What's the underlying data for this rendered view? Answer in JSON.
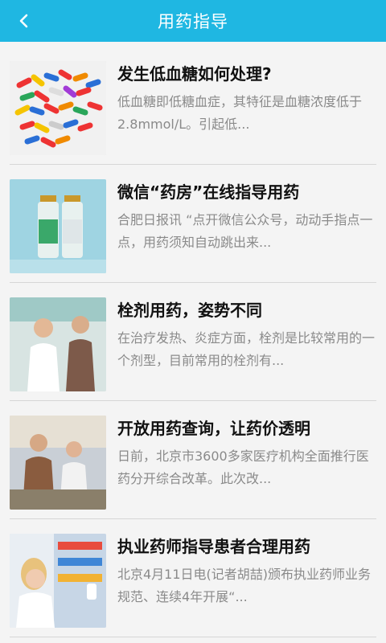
{
  "header": {
    "title": "用药指导",
    "back_icon": "chevron-left-icon"
  },
  "colors": {
    "accent": "#1fb7e2",
    "title_text": "#111111",
    "desc_text": "#8a8a8a"
  },
  "articles": [
    {
      "title": "发生低血糖如何处理?",
      "summary": "低血糖即低糖血症，其特征是血糖浓度低于2.8mmol/L。引起低...",
      "image": "pills-photo"
    },
    {
      "title": "微信“药房”在线指导用药",
      "summary": "合肥日报讯 “点开微信公众号，动动手指点一点，用药须知自动跳出来...",
      "image": "medicine-vials-photo"
    },
    {
      "title": "栓剂用药，姿势不同",
      "summary": "在治疗发热、炎症方面，栓剂是比较常用的一个剂型，目前常用的栓剂有...",
      "image": "doctor-consultation-photo"
    },
    {
      "title": "开放用药查询，让药价透明",
      "summary": "日前，北京市3600多家医疗机构全面推行医药分开综合改革。此次改...",
      "image": "pharmacy-counter-photo"
    },
    {
      "title": "执业药师指导患者合理用药",
      "summary": "北京4月11日电(记者胡喆)颁布执业药师业务规范、连续4年开展“...",
      "image": "pharmacist-photo"
    }
  ]
}
